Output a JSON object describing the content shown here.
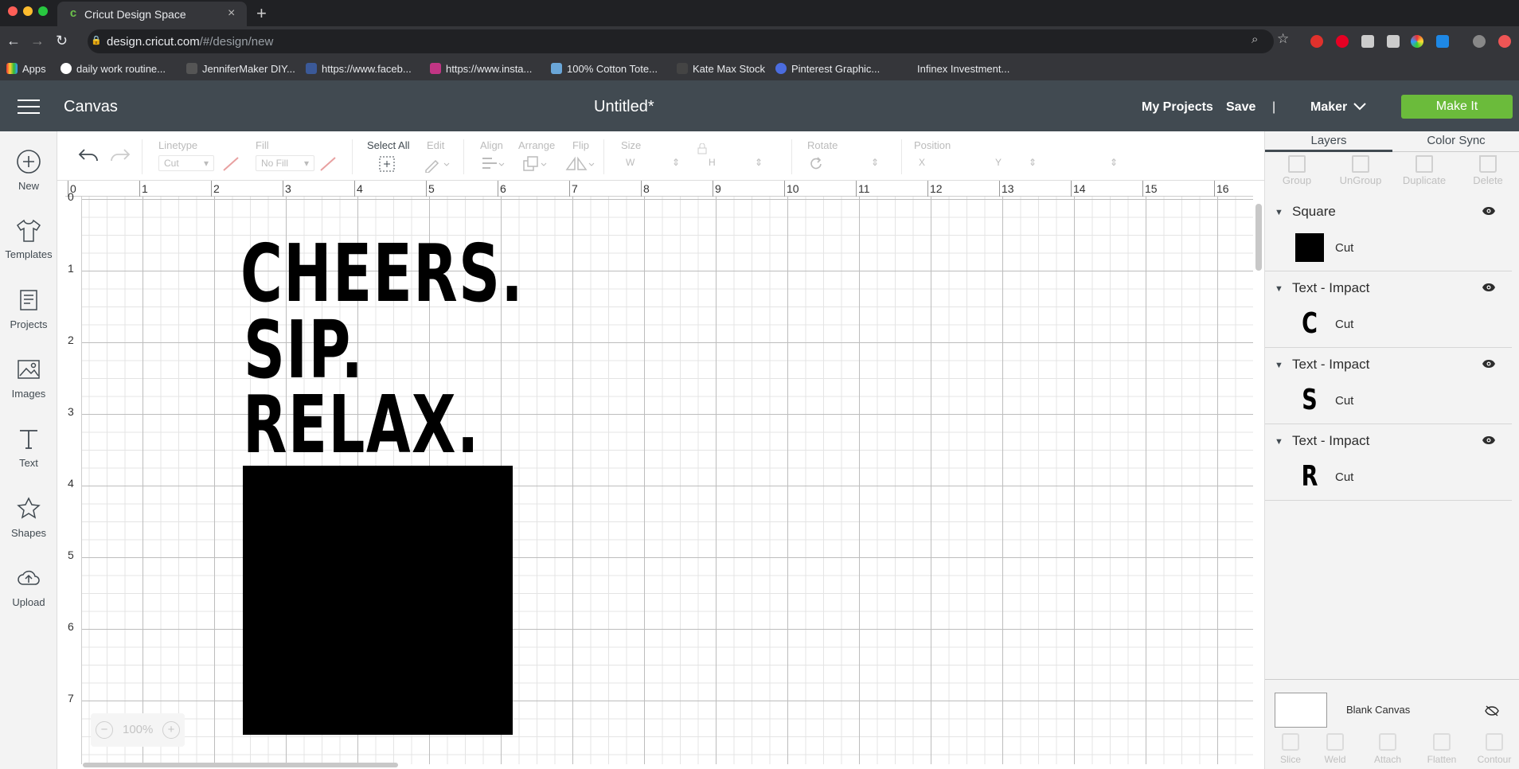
{
  "browser": {
    "tab_title": "Cricut Design Space",
    "new_tab": "+",
    "close": "×",
    "url_host": "design.cricut.com",
    "url_path": "/#/design/new",
    "bookmarks": [
      "Apps",
      "daily work routine...",
      "JenniferMaker DIY...",
      "https://www.faceb...",
      "https://www.insta...",
      "100% Cotton Tote...",
      "Kate Max Stock",
      "Pinterest Graphic...",
      "Infinex Investment..."
    ]
  },
  "header": {
    "section": "Canvas",
    "doc_title": "Untitled*",
    "my_projects": "My Projects",
    "save": "Save",
    "divider": "|",
    "machine": "Maker",
    "make_it": "Make It"
  },
  "leftnav": [
    "New",
    "Templates",
    "Projects",
    "Images",
    "Text",
    "Shapes",
    "Upload"
  ],
  "toolbar": {
    "linetype_label": "Linetype",
    "linetype_value": "Cut",
    "fill_label": "Fill",
    "fill_value": "No Fill",
    "select_all": "Select All",
    "edit": "Edit",
    "align": "Align",
    "arrange": "Arrange",
    "flip": "Flip",
    "size": "Size",
    "w": "W",
    "h": "H",
    "rotate": "Rotate",
    "position": "Position",
    "x": "X",
    "y": "Y"
  },
  "ruler": {
    "h": [
      "0",
      "1",
      "2",
      "3",
      "4",
      "5",
      "6",
      "7",
      "8",
      "9",
      "10",
      "11",
      "12",
      "13",
      "14",
      "15",
      "16"
    ],
    "v": [
      "0",
      "1",
      "2",
      "3",
      "4",
      "5",
      "6",
      "7"
    ]
  },
  "canvas": {
    "lines": [
      "CHEERS.",
      "SIP.",
      "RELAX."
    ],
    "zoom": "100%",
    "zoom_minus": "−",
    "zoom_plus": "+"
  },
  "panel": {
    "tabs": [
      "Layers",
      "Color Sync"
    ],
    "actions": [
      "Group",
      "UnGroup",
      "Duplicate",
      "Delete"
    ],
    "layers": [
      {
        "name": "Square",
        "glyph": "",
        "op": "Cut"
      },
      {
        "name": "Text - Impact",
        "glyph": "C",
        "op": "Cut"
      },
      {
        "name": "Text - Impact",
        "glyph": "S",
        "op": "Cut"
      },
      {
        "name": "Text - Impact",
        "glyph": "R",
        "op": "Cut"
      }
    ],
    "blank_canvas": "Blank Canvas",
    "bottom_actions": [
      "Slice",
      "Weld",
      "Attach",
      "Flatten",
      "Contour"
    ]
  },
  "colors": {
    "make_it": "#6bbb3b",
    "header": "#414a51"
  }
}
